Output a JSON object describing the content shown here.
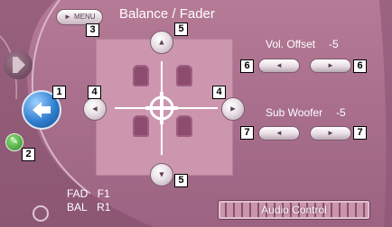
{
  "title": "Balance / Fader",
  "menu_button": {
    "label": "MENU",
    "icon": "play-triangle-icon"
  },
  "left_rail": {
    "speaker_icon": "speaker-icon",
    "return_icon": "return-arrow-icon",
    "setup_icon": "wrench-icon"
  },
  "fader_panel": {
    "arrow_up_icon": "triangle-up-icon",
    "arrow_down_icon": "triangle-down-icon",
    "arrow_left_icon": "triangle-left-icon",
    "arrow_right_icon": "triangle-right-icon",
    "target_icon": "crosshair-icon"
  },
  "vol_offset": {
    "label": "Vol. Offset",
    "value": "-5",
    "down_icon": "triangle-left-icon",
    "up_icon": "triangle-right-icon"
  },
  "sub_woofer": {
    "label": "Sub Woofer",
    "value": "-5",
    "down_icon": "triangle-left-icon",
    "up_icon": "triangle-right-icon"
  },
  "status": {
    "fad_label": "FAD",
    "fad_value": "F1",
    "bal_label": "BAL",
    "bal_value": "R1"
  },
  "audio_control": {
    "label": "Audio Control"
  },
  "callouts": {
    "c1": "1",
    "c2": "2",
    "c3": "3",
    "c4a": "4",
    "c4b": "4",
    "c5a": "5",
    "c5b": "5",
    "c6a": "6",
    "c6b": "6",
    "c7a": "7",
    "c7b": "7"
  },
  "colors": {
    "background": "#a96f8c",
    "panel": "#cc97ae",
    "accent_blue": "#2f7fd0",
    "text": "#ffffff"
  }
}
